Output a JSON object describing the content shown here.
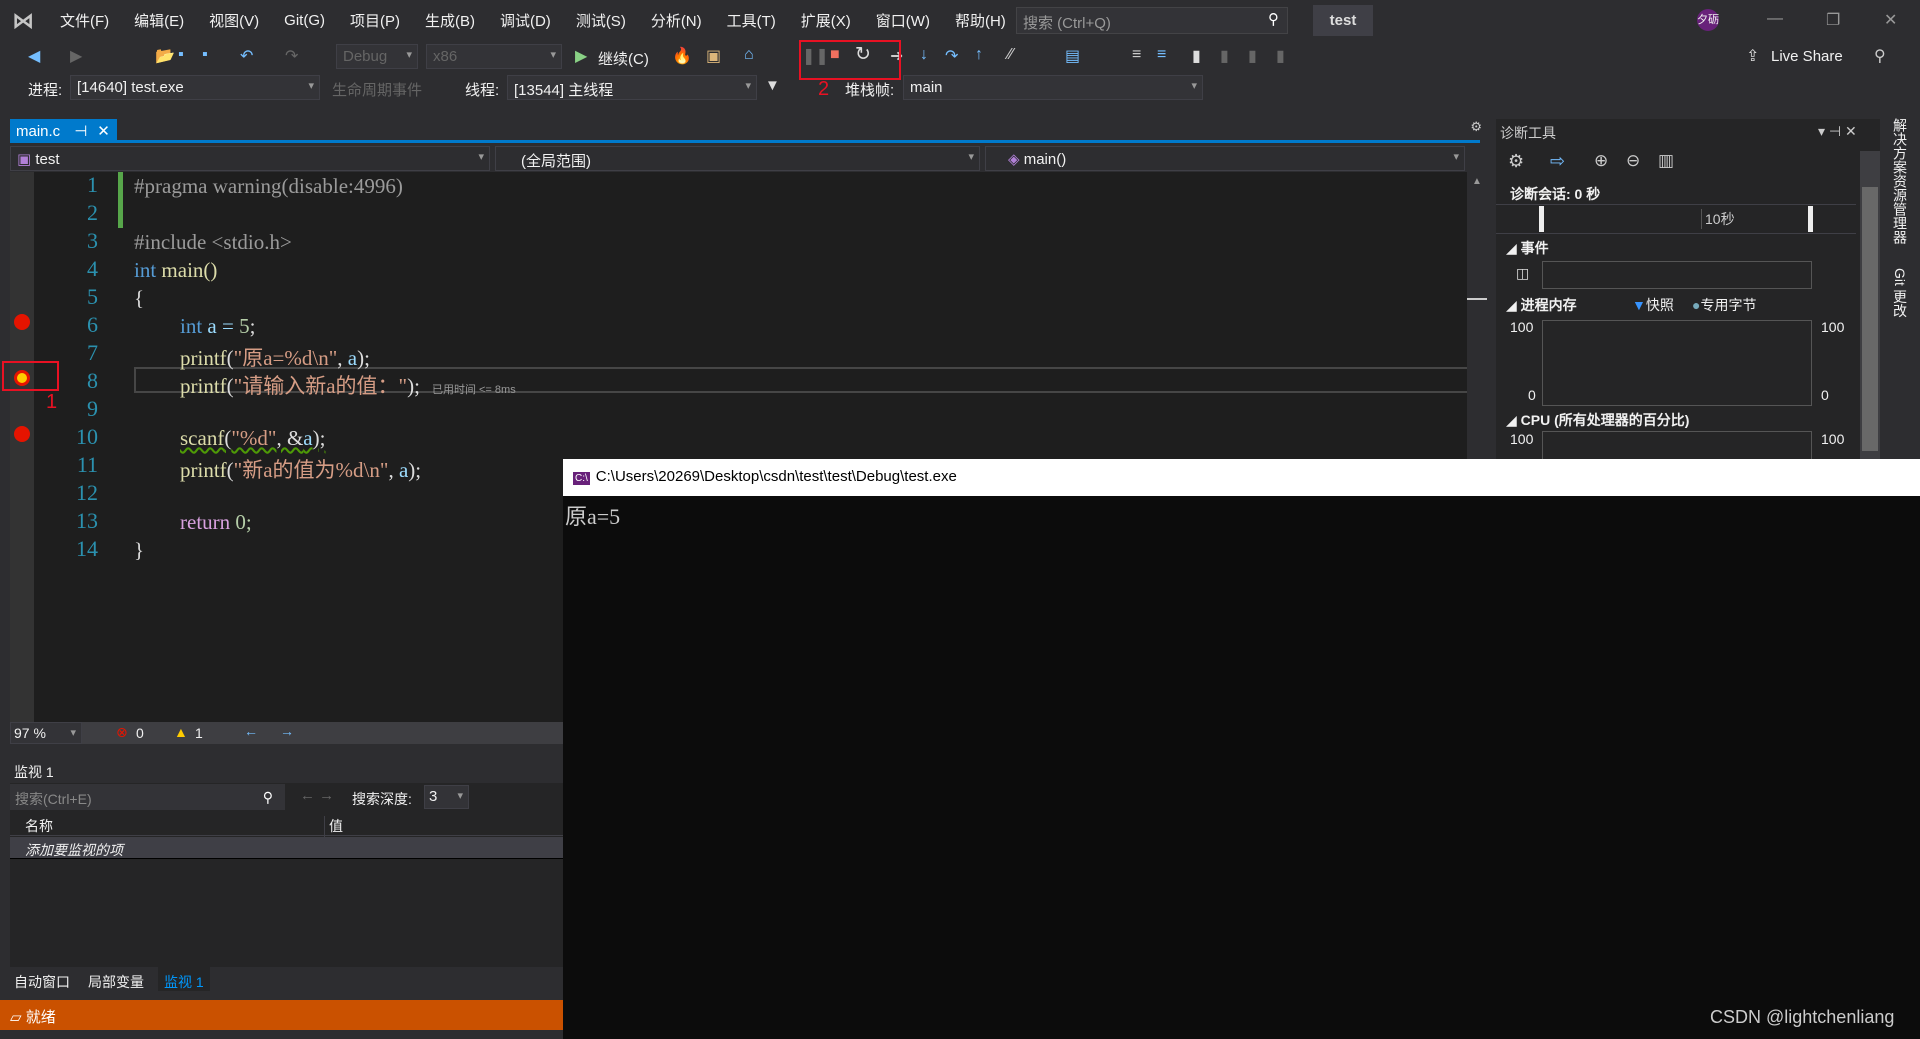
{
  "menu": {
    "items": [
      "文件(F)",
      "编辑(E)",
      "视图(V)",
      "Git(G)",
      "项目(P)",
      "生成(B)",
      "调试(D)",
      "测试(S)",
      "分析(N)",
      "工具(T)",
      "扩展(X)",
      "窗口(W)",
      "帮助(H)"
    ],
    "search_placeholder": "搜索 (Ctrl+Q)",
    "solution": "test",
    "avatar": "夕砺"
  },
  "toolbar": {
    "config": "Debug",
    "platform": "x86",
    "continue": "继续(C)",
    "live_share": "Live Share"
  },
  "debugbar": {
    "process_label": "进程:",
    "process": "[14640] test.exe",
    "lifecycle": "生命周期事件",
    "thread_label": "线程:",
    "thread": "[13544] 主线程",
    "stack_label": "堆栈帧:",
    "stack": "main"
  },
  "annotations": {
    "one": "1",
    "two": "2"
  },
  "editor": {
    "tab": "main.c",
    "project": "test",
    "scope": "(全局范围)",
    "function": "main()",
    "elapsed": "已用时间 <= 8ms",
    "zoom": "97 %",
    "errors": "0",
    "warnings": "1"
  },
  "code": {
    "lines": [
      "1",
      "2",
      "3",
      "4",
      "5",
      "6",
      "7",
      "8",
      "9",
      "10",
      "11",
      "12",
      "13",
      "14"
    ],
    "l1": "#pragma warning(disable:4996)",
    "l3": "#include <stdio.h>",
    "l4a": "int",
    "l4b": " main()",
    "l5": "{",
    "l6a": "int",
    "l6b": " a = ",
    "l6c": "5",
    "l6d": ";",
    "l7a": "printf",
    "l7b": "(",
    "l7c": "\"原a=%d\\n\"",
    "l7d": ", ",
    "l7e": "a",
    "l7f": ");",
    "l8a": "printf",
    "l8b": "(",
    "l8c": "\"请输入新a的值：\"",
    "l8d": ");",
    "l10a": "scanf",
    "l10b": "(",
    "l10c": "\"%d\"",
    "l10d": ", &",
    "l10e": "a",
    "l10f": ");",
    "l11a": "printf",
    "l11b": "(",
    "l11c": "\"新a的值为%d\\n\"",
    "l11d": ", ",
    "l11e": "a",
    "l11f": ");",
    "l13a": "return",
    "l13b": " 0;",
    "l14": "}"
  },
  "watch": {
    "title": "监视 1",
    "search_placeholder": "搜索(Ctrl+E)",
    "depth_label": "搜索深度:",
    "depth": "3",
    "col_name": "名称",
    "col_value": "值",
    "add_item": "添加要监视的项",
    "tabs": [
      "自动窗口",
      "局部变量",
      "监视 1"
    ]
  },
  "status": {
    "text": "就绪"
  },
  "diag": {
    "title": "诊断工具",
    "session": "诊断会话: 0 秒",
    "tick": "10秒",
    "events": "事件",
    "memory": "进程内存",
    "snapshot": "快照",
    "private_bytes": "专用字节",
    "cpu": "CPU (所有处理器的百分比)",
    "y100": "100",
    "y0": "0"
  },
  "side_tabs": [
    "解决方案资源管理器",
    "Git 更改"
  ],
  "console": {
    "title": "C:\\Users\\20269\\Desktop\\csdn\\test\\test\\Debug\\test.exe",
    "output": "原a=5"
  },
  "watermark": "CSDN @lightchenliang"
}
